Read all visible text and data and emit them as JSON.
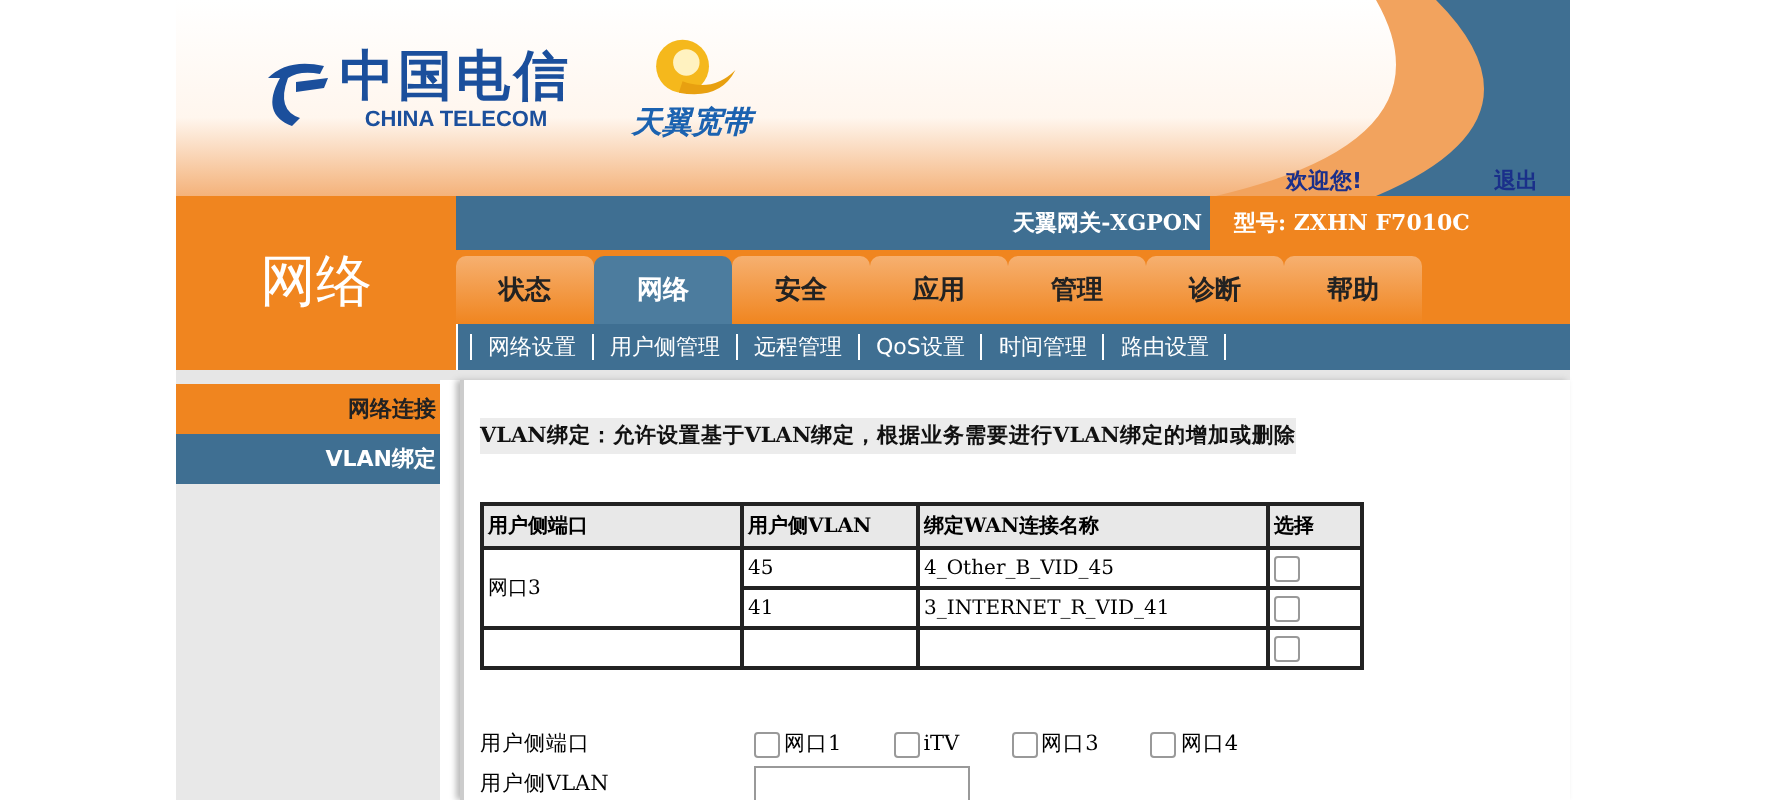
{
  "header": {
    "brand_cn": "中国电信",
    "brand_en": "CHINA TELECOM",
    "product": "天翼宽带",
    "welcome": "欢迎您!",
    "logout": "退出"
  },
  "topbar": {
    "gateway": "天翼网关-XGPON",
    "model": "型号: ZXHN F7010C"
  },
  "section_title": "网络",
  "tabs": [
    {
      "label": "状态",
      "selected": false
    },
    {
      "label": "网络",
      "selected": true
    },
    {
      "label": "安全",
      "selected": false
    },
    {
      "label": "应用",
      "selected": false
    },
    {
      "label": "管理",
      "selected": false
    },
    {
      "label": "诊断",
      "selected": false
    },
    {
      "label": "帮助",
      "selected": false
    }
  ],
  "subnav": [
    "网络设置",
    "用户侧管理",
    "远程管理",
    "QoS设置",
    "时间管理",
    "路由设置"
  ],
  "sidebar": {
    "items": [
      {
        "label": "网络连接",
        "selected": false
      },
      {
        "label": "VLAN绑定",
        "selected": true
      }
    ]
  },
  "description": "VLAN绑定：允许设置基于VLAN绑定，根据业务需要进行VLAN绑定的增加或删除",
  "table": {
    "columns": [
      "用户侧端口",
      "用户侧VLAN",
      "绑定WAN连接名称",
      "选择"
    ],
    "rows": [
      {
        "port": "网口3",
        "entries": [
          {
            "vlan": "45",
            "wan": "4_Other_B_VID_45",
            "checked": false
          },
          {
            "vlan": "41",
            "wan": "3_INTERNET_R_VID_41",
            "checked": false
          }
        ]
      },
      {
        "entries": [
          {
            "checked": false
          }
        ]
      }
    ]
  },
  "form": {
    "port_label": "用户侧端口",
    "ports": [
      {
        "label": "网口1",
        "checked": false
      },
      {
        "label": "iTV",
        "checked": false
      },
      {
        "label": "网口3",
        "checked": false
      },
      {
        "label": "网口4",
        "checked": false
      }
    ],
    "vlan_label": "用户侧VLAN"
  }
}
